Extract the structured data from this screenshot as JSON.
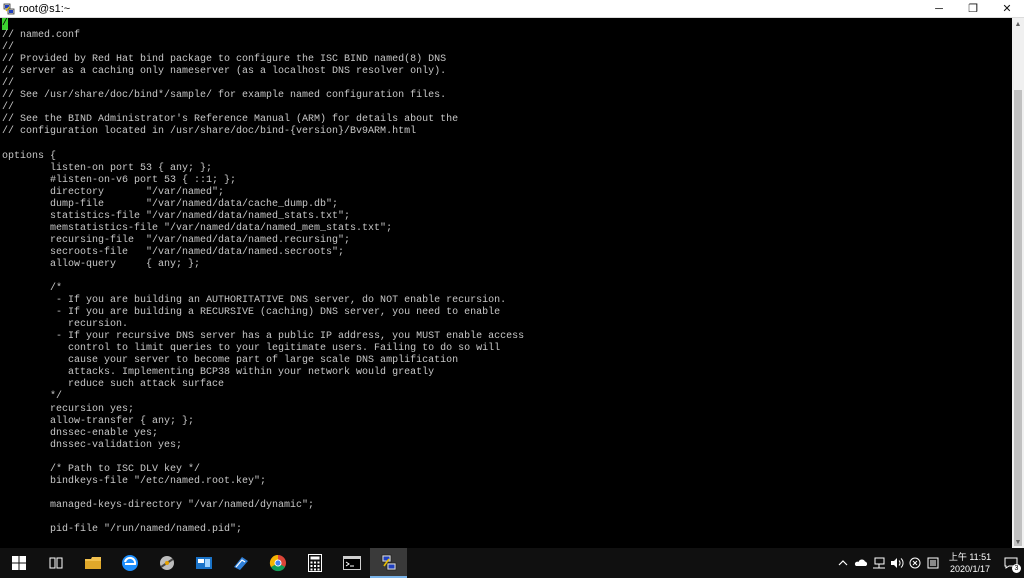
{
  "window": {
    "title": "root@s1:~",
    "minimize": "─",
    "restore": "❐",
    "close": "✕"
  },
  "terminal": {
    "cursor_char": "/",
    "lines": [
      "/",
      "// named.conf",
      "//",
      "// Provided by Red Hat bind package to configure the ISC BIND named(8) DNS",
      "// server as a caching only nameserver (as a localhost DNS resolver only).",
      "//",
      "// See /usr/share/doc/bind*/sample/ for example named configuration files.",
      "//",
      "// See the BIND Administrator's Reference Manual (ARM) for details about the",
      "// configuration located in /usr/share/doc/bind-{version}/Bv9ARM.html",
      "",
      "options {",
      "        listen-on port 53 { any; };",
      "        #listen-on-v6 port 53 { ::1; };",
      "        directory       \"/var/named\";",
      "        dump-file       \"/var/named/data/cache_dump.db\";",
      "        statistics-file \"/var/named/data/named_stats.txt\";",
      "        memstatistics-file \"/var/named/data/named_mem_stats.txt\";",
      "        recursing-file  \"/var/named/data/named.recursing\";",
      "        secroots-file   \"/var/named/data/named.secroots\";",
      "        allow-query     { any; };",
      "",
      "        /*",
      "         - If you are building an AUTHORITATIVE DNS server, do NOT enable recursion.",
      "         - If you are building a RECURSIVE (caching) DNS server, you need to enable",
      "           recursion.",
      "         - If your recursive DNS server has a public IP address, you MUST enable access",
      "           control to limit queries to your legitimate users. Failing to do so will",
      "           cause your server to become part of large scale DNS amplification",
      "           attacks. Implementing BCP38 within your network would greatly",
      "           reduce such attack surface",
      "        */",
      "        recursion yes;",
      "        allow-transfer { any; };",
      "        dnssec-enable yes;",
      "        dnssec-validation yes;",
      "",
      "        /* Path to ISC DLV key */",
      "        bindkeys-file \"/etc/named.root.key\";",
      "",
      "        managed-keys-directory \"/var/named/dynamic\";",
      "",
      "        pid-file \"/run/named/named.pid\";",
      ""
    ]
  },
  "taskbar": {
    "items": [
      {
        "name": "start-button",
        "icon": "windows-logo-icon",
        "active": false
      },
      {
        "name": "task-view-button",
        "icon": "task-view-icon",
        "active": false
      },
      {
        "name": "file-explorer-button",
        "icon": "folder-icon",
        "active": false
      },
      {
        "name": "edge-button",
        "icon": "edge-icon",
        "active": false
      },
      {
        "name": "network-tool-button",
        "icon": "network-tool-icon",
        "active": false
      },
      {
        "name": "mail-button",
        "icon": "mail-icon",
        "active": false
      },
      {
        "name": "remote-desktop-button",
        "icon": "remote-icon",
        "active": false
      },
      {
        "name": "chrome-button",
        "icon": "chrome-icon",
        "active": false
      },
      {
        "name": "calculator-button",
        "icon": "calculator-icon",
        "active": false
      },
      {
        "name": "console-button",
        "icon": "console-icon",
        "active": false
      },
      {
        "name": "putty-button",
        "icon": "putty-icon",
        "active": true
      }
    ],
    "clock_time": "上午 11:51",
    "clock_date": "2020/1/17",
    "notification_count": "3"
  }
}
